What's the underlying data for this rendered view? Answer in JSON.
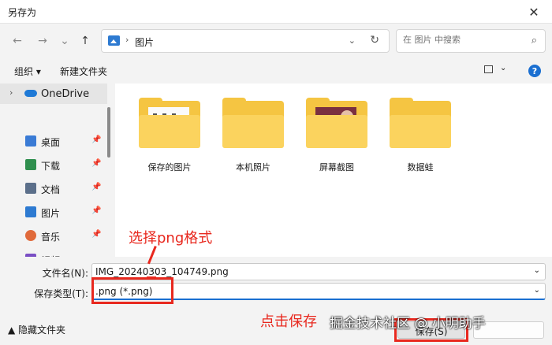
{
  "window": {
    "title": "另存为",
    "close_glyph": "✕"
  },
  "nav": {
    "back": "←",
    "forward": "→",
    "recent": "⌄",
    "up": "↑"
  },
  "address": {
    "separator": "›",
    "path": "图片",
    "dropdown": "⌄",
    "refresh": "↻"
  },
  "search": {
    "placeholder": "在 图片 中搜索",
    "icon": "search-icon"
  },
  "toolbar": {
    "organize": "组织 ▾",
    "new_folder": "新建文件夹",
    "view_dd": "⌄",
    "help": "?"
  },
  "sidebar": {
    "onedrive": {
      "chevron": "›",
      "label": "OneDrive"
    },
    "items": [
      {
        "label": "桌面",
        "icon": "desktop-icon",
        "pin": "📌",
        "color": "#3a7bd5"
      },
      {
        "label": "下载",
        "icon": "download-icon",
        "pin": "📌",
        "color": "#2f8f4e"
      },
      {
        "label": "文档",
        "icon": "documents-icon",
        "pin": "📌",
        "color": "#5b6f8a"
      },
      {
        "label": "图片",
        "icon": "pictures-icon",
        "pin": "📌",
        "color": "#2d7ad1"
      },
      {
        "label": "音乐",
        "icon": "music-icon",
        "pin": "📌",
        "color": "#e06a3b"
      },
      {
        "label": "视频",
        "icon": "videos-icon",
        "pin": "📌",
        "color": "#7a4fc4"
      }
    ]
  },
  "folders": [
    {
      "label": "保存的图片",
      "thumb": "ui"
    },
    {
      "label": "本机照片",
      "thumb": "none"
    },
    {
      "label": "屏幕截图",
      "thumb": "shot"
    },
    {
      "label": "数据蛙",
      "thumb": "none"
    }
  ],
  "form": {
    "filename_label": "文件名(N):",
    "filename_value": "IMG_20240303_104749.png",
    "type_label": "保存类型(T):",
    "type_value": ".png (*.png)",
    "dropdown": "⌄"
  },
  "footer": {
    "hide_folders": "▲  隐藏文件夹",
    "save_label": "保存(S)"
  },
  "annotations": {
    "select_png": "选择png格式",
    "click_save": "点击保存"
  },
  "watermark": "掘金技术社区 @ 小明助手",
  "colors": {
    "accent": "#1a6fd1",
    "annotation": "#e8281e",
    "folder": "#f5c542"
  }
}
